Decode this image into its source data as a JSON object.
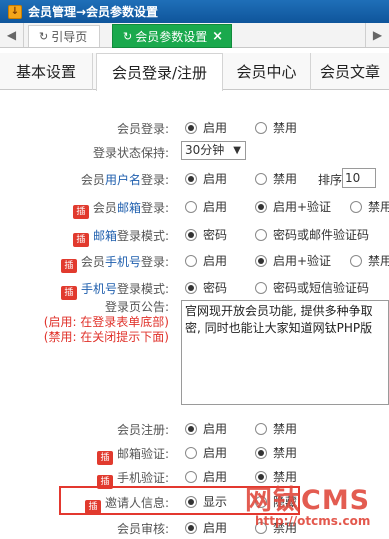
{
  "title": {
    "icon": "download-arrow-icon",
    "text": "会员管理→会员参数设置"
  },
  "tabs": [
    {
      "label": "引导页",
      "icon": "refresh-icon"
    },
    {
      "label": "会员参数设置",
      "icon": "refresh-icon",
      "close": "×"
    }
  ],
  "nav": {
    "left": "◀",
    "right": "▶"
  },
  "subtabs": [
    "基本设置",
    "会员登录/注册",
    "会员中心",
    "会员文章"
  ],
  "active_subtab": "会员登录/注册",
  "rows": {
    "login": {
      "label": "会员登录:",
      "o1": "启用",
      "o2": "禁用"
    },
    "keep": {
      "label": "登录状态保持:",
      "value": "30分钟",
      "caret": "▼"
    },
    "username": {
      "pre": "会员",
      "blue": "用户名",
      "post": "登录:",
      "o1": "启用",
      "o2": "禁用",
      "sort_label": "排序",
      "sort_value": "10"
    },
    "email_login": {
      "ins": "插",
      "pre": "会员",
      "blue": "邮箱",
      "post": "登录:",
      "o1": "启用",
      "o2": "启用+验证",
      "o3": "禁用"
    },
    "email_mode": {
      "ins": "插",
      "blue": "邮箱",
      "post": "登录模式:",
      "o1": "密码",
      "o2": "密码或邮件验证码"
    },
    "phone_login": {
      "ins": "插",
      "pre": "会员",
      "blue": "手机号",
      "post": "登录:",
      "o1": "启用",
      "o2": "启用+验证",
      "o3": "禁用"
    },
    "phone_mode": {
      "ins": "插",
      "blue": "手机号",
      "post": "登录模式:",
      "o1": "密码",
      "o2": "密码或短信验证码"
    },
    "notice": {
      "label": "登录页公告:",
      "hint1": "(启用: 在登录表单底部)",
      "hint2": "(禁用: 在关闭提示下面)",
      "text_line1": "官网现开放会员功能, 提供多种争取",
      "text_line2": "密, 同时也能让大家知道网钛PHP版"
    },
    "register": {
      "label": "会员注册:",
      "o1": "启用",
      "o2": "禁用"
    },
    "email_verify": {
      "ins": "插",
      "label": "邮箱验证:",
      "o1": "启用",
      "o2": "禁用"
    },
    "phone_verify": {
      "ins": "插",
      "label": "手机验证:",
      "o1": "启用",
      "o2": "禁用"
    },
    "invite": {
      "ins": "插",
      "label": "邀请人信息:",
      "o1": "显示",
      "o2": "隐藏"
    },
    "audit": {
      "label": "会员审核:",
      "o1": "启用",
      "o2": "禁用"
    }
  },
  "watermark": {
    "brand": "网钛CMS",
    "url": "http://otcms.com"
  }
}
